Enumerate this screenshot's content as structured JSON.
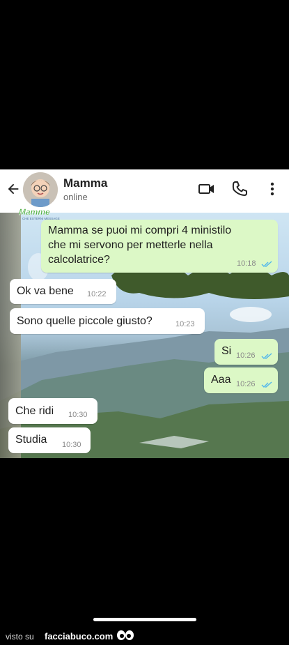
{
  "header": {
    "contact_name": "Mamma",
    "status": "online",
    "avatar_watermark": "Mamme"
  },
  "messages": [
    {
      "direction": "out",
      "text_lines": [
        "Mamma se puoi mi compri 4 ministilo",
        "che mi servono per metterle nella",
        "calcolatrice?"
      ],
      "time": "10:18",
      "ticks": "read"
    },
    {
      "direction": "in",
      "text": "Ok va bene",
      "time": "10:22"
    },
    {
      "direction": "in",
      "text": "Sono quelle piccole giusto?",
      "time": "10:23"
    },
    {
      "direction": "out",
      "text": "Si",
      "time": "10:26",
      "ticks": "read"
    },
    {
      "direction": "out",
      "text": "Aaa",
      "time": "10:26",
      "ticks": "read"
    },
    {
      "direction": "in",
      "text": "Che ridi",
      "time": "10:30"
    },
    {
      "direction": "in",
      "text": "Studia",
      "time": "10:30"
    }
  ],
  "footer": {
    "visto_su": "visto su",
    "brand": "facciabuco.com"
  },
  "colors": {
    "outgoing_bubble": "#dcf8c6",
    "incoming_bubble": "#ffffff",
    "read_ticks": "#4fb6ec"
  },
  "icons": [
    "back-arrow-icon",
    "video-call-icon",
    "phone-icon",
    "more-vert-icon",
    "double-check-icon"
  ]
}
